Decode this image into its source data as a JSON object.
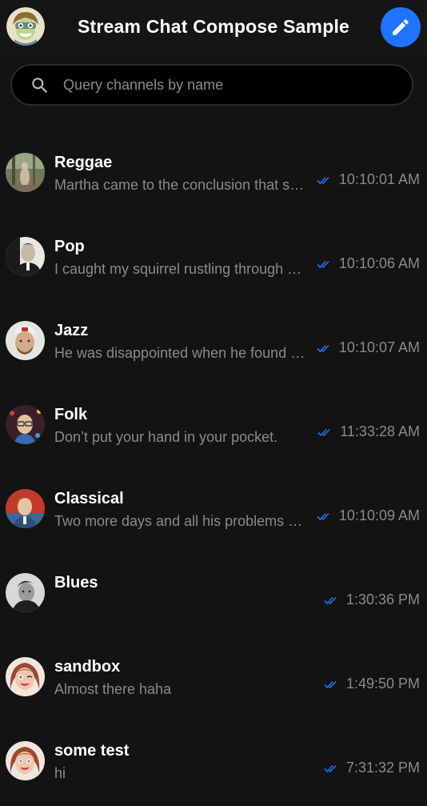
{
  "header": {
    "title": "Stream Chat Compose Sample",
    "avatar_icon": "user-avatar-icon",
    "compose_icon": "pencil-icon"
  },
  "search": {
    "placeholder": "Query channels by name",
    "value": ""
  },
  "colors": {
    "background": "#131313",
    "accent": "#1e74ff",
    "secondary_text": "#8a8a8e",
    "read_indicator": "#1e74ff"
  },
  "channels": [
    {
      "name": "Reggae",
      "preview": "Martha came to the conclusion that shutting down her computer was the best choice",
      "time": "10:10:01 AM",
      "status_icon": "double-check-icon"
    },
    {
      "name": "Pop",
      "preview": "I caught my squirrel rustling through my gym bag.",
      "time": "10:10:06 AM",
      "status_icon": "double-check-icon"
    },
    {
      "name": "Jazz",
      "preview": "He was disappointed when he found the beach to be so sandy",
      "time": "10:10:07 AM",
      "status_icon": "double-check-icon"
    },
    {
      "name": "Folk",
      "preview": "Don’t put your hand in your pocket.",
      "time": "11:33:28 AM",
      "status_icon": "double-check-icon"
    },
    {
      "name": "Classical",
      "preview": "Two more days and all his problems would be solved.",
      "time": "10:10:09 AM",
      "status_icon": "double-check-icon"
    },
    {
      "name": "Blues",
      "preview": "",
      "time": "1:30:36 PM",
      "status_icon": "double-check-icon"
    },
    {
      "name": "sandbox",
      "preview": "Almost there haha",
      "time": "1:49:50 PM",
      "status_icon": "double-check-icon"
    },
    {
      "name": "some test",
      "preview": "hi",
      "time": "7:31:32 PM",
      "status_icon": "double-check-icon"
    }
  ]
}
